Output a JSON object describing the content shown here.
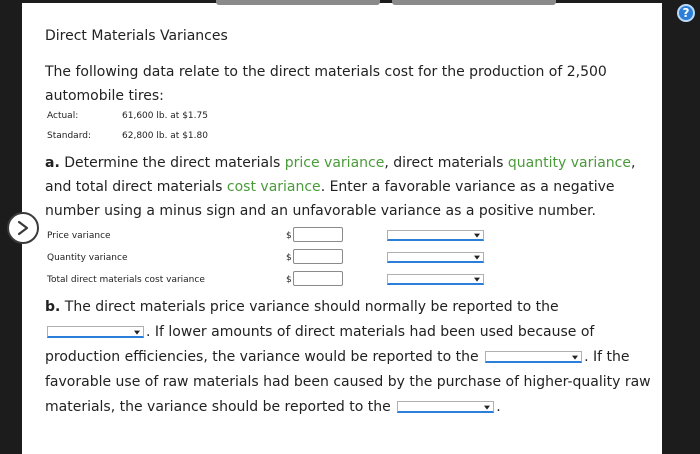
{
  "heading": "Direct Materials Variances",
  "intro": "The following data relate to the direct materials cost for the production of 2,500 automobile tires:",
  "data": [
    {
      "label": "Actual:",
      "value": "61,600 lb. at $1.75"
    },
    {
      "label": "Standard:",
      "value": "62,800 lb. at $1.80"
    }
  ],
  "partA": {
    "letter": "a.",
    "text1": " Determine the direct materials ",
    "term1": "price variance",
    "text2": ", direct materials ",
    "term2": "quantity variance",
    "text3": ", and total direct materials ",
    "term3": "cost variance",
    "text4": ". Enter a favorable variance as a negative number using a minus sign and an unfavorable variance as a positive number."
  },
  "rows": [
    {
      "label": "Price variance",
      "currency": "$"
    },
    {
      "label": "Quantity variance",
      "currency": "$"
    },
    {
      "label": "Total direct materials cost variance",
      "currency": "$"
    }
  ],
  "partB": {
    "letter": "b.",
    "text1": " The direct materials price variance should normally be reported to the ",
    "text2": ". If lower amounts of direct materials had been used because of production efficiencies, the variance would be reported to the ",
    "text3": ". If the favorable use of raw materials had been caused by the purchase of higher-quality raw materials, the variance should be reported to the ",
    "text4": "."
  },
  "help_glyph": "?"
}
